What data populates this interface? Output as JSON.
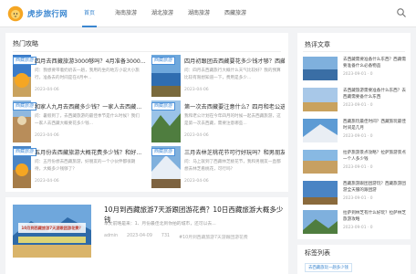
{
  "site": {
    "name": "虎步旅行网"
  },
  "nav": {
    "items": [
      {
        "label": "首页",
        "active": true
      },
      {
        "label": "海南旅游",
        "active": false
      },
      {
        "label": "湖北旅游",
        "active": false
      },
      {
        "label": "湖南旅游",
        "active": false
      },
      {
        "label": "西藏旅游",
        "active": false
      }
    ]
  },
  "hot_posts": {
    "title": "热门攻略",
    "posts": [
      {
        "tag": "西藏旅游",
        "title": "四月去西藏旅游3000够吗？4月准备3000...",
        "excerpt": "问：我想要带着奶奶去一趟，我用的坐的地方小说大小旅行，准备去的时间是在4月中...",
        "meta": "2023-04-06"
      },
      {
        "tag": "西藏旅游",
        "title": "四月初跟团去西藏要花多少钱才够？西藏...",
        "excerpt": "问：四月去西藏旅行大概什么天气比较好？我的预算比较有限想知道一下，费用是多少...",
        "meta": "2023-04-06"
      },
      {
        "tag": "西藏旅游",
        "title": "和家人九月去西藏多少钱？一家人去西藏...",
        "excerpt": "问：暑假到了，去西藏旅游的最佳季节是什么时候？我们一家人去西藏大概要花多少钱...",
        "meta": "2023-04-06"
      },
      {
        "tag": "西藏旅游",
        "title": "第一次去西藏要注意什么？四月和老公选...",
        "excerpt": "我和老公计划在今年四月的时候一起去西藏旅游，这是第一次去西藏，需要注意哪些...",
        "meta": "2023-04-06"
      },
      {
        "tag": "西藏旅游",
        "title": "五月份去西藏旅游大概花费多少钱？和好...",
        "excerpt": "问：五月份想去西藏旅游，好朋友的一个小伙伴都很期待，大概多少钱够了？",
        "meta": "2023-04-06"
      },
      {
        "tag": "西藏旅游",
        "title": "三月去林芝桃花节可行好玩吗？和男朋友去西...",
        "excerpt": "问：马上就到了西藏林芝桃花节，我和男朋友一直都想去林芝看桃花，可行吗？",
        "meta": "2023-04-06"
      }
    ]
  },
  "featured": {
    "thumb_caption": "10月到西藏旅游7天游跟团游花费？",
    "title": "10月到西藏旅游7天游跟团游花费？10日西藏旅游大概多少钱",
    "excerpt": "本文前略是来：1、月份最佳北到你拍的城市，还可以去...",
    "author": "admin",
    "date": "2023-04-09",
    "views": "731",
    "tags": "#10月到西藏旅游7天游跟团游花费"
  },
  "hot_articles": {
    "title": "热评文章",
    "items": [
      {
        "title": "去西藏需要准备什么东西？西藏需要准备什么必备物品",
        "date": "2023-09-01",
        "comments": "0"
      },
      {
        "title": "去西藏旅游需要准备什么东西？去西藏需要备什么东西",
        "date": "2023-09-01",
        "comments": "0"
      },
      {
        "title": "西藏旅玩最佳时间？西藏旅玩最佳时间是几月",
        "date": "2023-09-01",
        "comments": "0"
      },
      {
        "title": "拉萨旅游景点攻略？拉萨旅游景点一个人多少钱",
        "date": "2023-09-01",
        "comments": "0"
      },
      {
        "title": "西藏旅游跟团团游玩？西藏旅游团游全天服的跟团游",
        "date": "2023-09-01",
        "comments": "0"
      },
      {
        "title": "拉萨到林芝有什么好玩？拉萨林芝旅游攻略",
        "date": "2023-09-01",
        "comments": "0"
      }
    ]
  },
  "tag_list": {
    "title": "标签列表",
    "chip": "去西藏旅玩一趟多少钱"
  }
}
